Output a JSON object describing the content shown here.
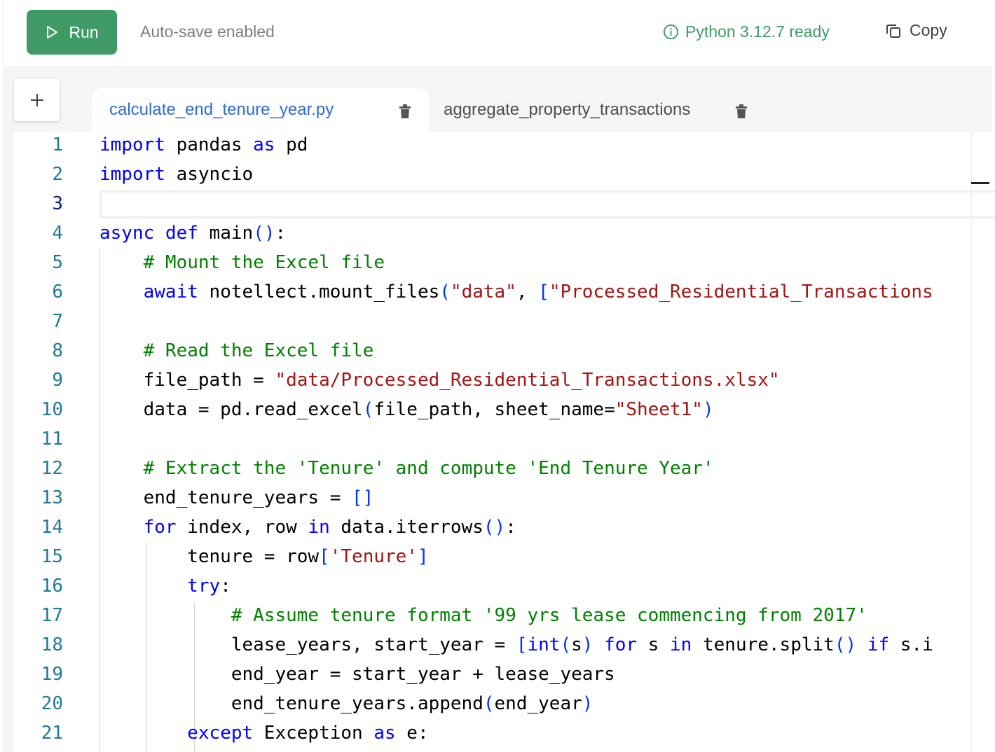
{
  "toolbar": {
    "run_label": "Run",
    "autosave_text": "Auto-save enabled",
    "status_text": "Python 3.12.7 ready",
    "copy_label": "Copy"
  },
  "tabs": [
    {
      "label": "calculate_end_tenure_year.py",
      "active": true
    },
    {
      "label": "aggregate_property_transactions",
      "active": false
    }
  ],
  "editor": {
    "current_line": 3,
    "lines": [
      {
        "n": "1",
        "tokens": [
          [
            "kw",
            "import"
          ],
          [
            "pl",
            " pandas "
          ],
          [
            "kw",
            "as"
          ],
          [
            "pl",
            " pd"
          ]
        ]
      },
      {
        "n": "2",
        "tokens": [
          [
            "kw",
            "import"
          ],
          [
            "pl",
            " asyncio"
          ]
        ]
      },
      {
        "n": "3",
        "tokens": []
      },
      {
        "n": "4",
        "tokens": [
          [
            "kw",
            "async"
          ],
          [
            "pl",
            " "
          ],
          [
            "kw",
            "def"
          ],
          [
            "pl",
            " main"
          ],
          [
            "br",
            "()"
          ],
          [
            "pl",
            ":"
          ]
        ]
      },
      {
        "n": "5",
        "tokens": [
          [
            "pl",
            "    "
          ],
          [
            "cm",
            "# Mount the Excel file"
          ]
        ]
      },
      {
        "n": "6",
        "tokens": [
          [
            "pl",
            "    "
          ],
          [
            "kw",
            "await"
          ],
          [
            "pl",
            " notellect.mount_files"
          ],
          [
            "br",
            "("
          ],
          [
            "st",
            "\"data\""
          ],
          [
            "pl",
            ", "
          ],
          [
            "br",
            "["
          ],
          [
            "st",
            "\"Processed_Residential_Transactions"
          ]
        ]
      },
      {
        "n": "7",
        "tokens": []
      },
      {
        "n": "8",
        "tokens": [
          [
            "pl",
            "    "
          ],
          [
            "cm",
            "# Read the Excel file"
          ]
        ]
      },
      {
        "n": "9",
        "tokens": [
          [
            "pl",
            "    file_path = "
          ],
          [
            "st",
            "\"data/Processed_Residential_Transactions.xlsx\""
          ]
        ]
      },
      {
        "n": "10",
        "tokens": [
          [
            "pl",
            "    data = pd.read_excel"
          ],
          [
            "br",
            "("
          ],
          [
            "pl",
            "file_path, sheet_name="
          ],
          [
            "st",
            "\"Sheet1\""
          ],
          [
            "br",
            ")"
          ]
        ]
      },
      {
        "n": "11",
        "tokens": []
      },
      {
        "n": "12",
        "tokens": [
          [
            "pl",
            "    "
          ],
          [
            "cm",
            "# Extract the 'Tenure' and compute 'End Tenure Year'"
          ]
        ]
      },
      {
        "n": "13",
        "tokens": [
          [
            "pl",
            "    end_tenure_years = "
          ],
          [
            "br",
            "[]"
          ]
        ]
      },
      {
        "n": "14",
        "tokens": [
          [
            "pl",
            "    "
          ],
          [
            "kw",
            "for"
          ],
          [
            "pl",
            " index, row "
          ],
          [
            "kw",
            "in"
          ],
          [
            "pl",
            " data.iterrows"
          ],
          [
            "br",
            "()"
          ],
          [
            "pl",
            ":"
          ]
        ]
      },
      {
        "n": "15",
        "tokens": [
          [
            "pl",
            "        tenure = row"
          ],
          [
            "br",
            "["
          ],
          [
            "st",
            "'Tenure'"
          ],
          [
            "br",
            "]"
          ]
        ]
      },
      {
        "n": "16",
        "tokens": [
          [
            "pl",
            "        "
          ],
          [
            "kw",
            "try"
          ],
          [
            "pl",
            ":"
          ]
        ]
      },
      {
        "n": "17",
        "tokens": [
          [
            "pl",
            "            "
          ],
          [
            "cm",
            "# Assume tenure format '99 yrs lease commencing from 2017'"
          ]
        ]
      },
      {
        "n": "18",
        "tokens": [
          [
            "pl",
            "            lease_years, start_year = "
          ],
          [
            "br",
            "["
          ],
          [
            "kw",
            "int"
          ],
          [
            "br",
            "("
          ],
          [
            "pl",
            "s"
          ],
          [
            "br",
            ")"
          ],
          [
            "pl",
            " "
          ],
          [
            "kw",
            "for"
          ],
          [
            "pl",
            " s "
          ],
          [
            "kw",
            "in"
          ],
          [
            "pl",
            " tenure.split"
          ],
          [
            "br",
            "()"
          ],
          [
            "pl",
            " "
          ],
          [
            "kw",
            "if"
          ],
          [
            "pl",
            " s.i"
          ]
        ]
      },
      {
        "n": "19",
        "tokens": [
          [
            "pl",
            "            end_year = start_year + lease_years"
          ]
        ]
      },
      {
        "n": "20",
        "tokens": [
          [
            "pl",
            "            end_tenure_years.append"
          ],
          [
            "br",
            "("
          ],
          [
            "pl",
            "end_year"
          ],
          [
            "br",
            ")"
          ]
        ]
      },
      {
        "n": "21",
        "tokens": [
          [
            "pl",
            "        "
          ],
          [
            "kw",
            "except"
          ],
          [
            "pl",
            " Exception "
          ],
          [
            "kw",
            "as"
          ],
          [
            "pl",
            " e:"
          ]
        ]
      }
    ]
  }
}
